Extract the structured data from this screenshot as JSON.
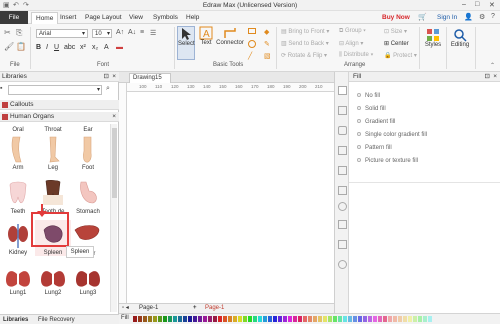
{
  "app": {
    "title": "Edraw Max (Unlicensed Version)",
    "min": "–",
    "max": "□",
    "close": "✕"
  },
  "menu": {
    "file": "File",
    "items": [
      "Home",
      "Insert",
      "Page Layout",
      "View",
      "Symbols",
      "Help"
    ],
    "buy_now": "Buy Now",
    "sign_in": "Sign In"
  },
  "ribbon": {
    "font_name": "Arial",
    "font_size": "10",
    "groups": {
      "file": "File",
      "font": "Font",
      "basic_tools": "Basic Tools",
      "arrange": "Arrange"
    },
    "select": "Select",
    "text": "Text",
    "connector": "Connector",
    "bring_front": "Bring to Front",
    "send_back": "Send to Back",
    "rotate_flip": "Rotate & Flip",
    "group": "Group",
    "align": "Align",
    "distribute": "Distribute",
    "size": "Size",
    "center": "Center",
    "protect": "Protect",
    "styles": "Styles",
    "editing": "Editing"
  },
  "libraries": {
    "title": "Libraries",
    "categories": [
      "Callouts",
      "Human Organs"
    ],
    "shapes": [
      {
        "label": "Oral"
      },
      {
        "label": "Throat"
      },
      {
        "label": "Ear"
      },
      {
        "label": "Arm"
      },
      {
        "label": "Leg"
      },
      {
        "label": "Foot"
      },
      {
        "label": "Teeth"
      },
      {
        "label": "Tooth de"
      },
      {
        "label": "Stomach"
      },
      {
        "label": "Kidney"
      },
      {
        "label": "Spleen"
      },
      {
        "label": "Spleen"
      },
      {
        "label": "Lung1"
      },
      {
        "label": "Lung2"
      },
      {
        "label": "Lung3"
      }
    ],
    "drag_label_suffix": "er",
    "tabs": [
      "Libraries",
      "File Recovery"
    ]
  },
  "document": {
    "tab": "Drawing15",
    "ruler_ticks": [
      "100",
      "110",
      "120",
      "130",
      "140",
      "150",
      "160",
      "170",
      "180",
      "190",
      "200",
      "210"
    ],
    "page_tab_a": "Page-1",
    "page_tab_b": "Page-1",
    "fill_label": "Fill"
  },
  "fill": {
    "title": "Fill",
    "options": [
      "No fill",
      "Solid fill",
      "Gradient fill",
      "Single color gradient fill",
      "Pattern fill",
      "Picture or texture fill"
    ]
  },
  "colors": {
    "accent_red": "#d7262b",
    "link_blue": "#1e5ca8",
    "file_tab_bg": "#3a3a3a",
    "selection_red": "#e23b3b"
  }
}
